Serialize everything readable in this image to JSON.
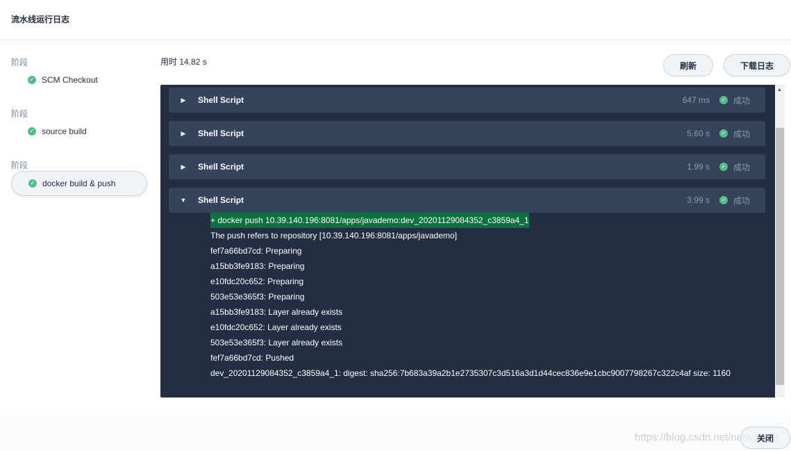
{
  "header": {
    "title": "流水线运行日志"
  },
  "stages": [
    {
      "label": "阶段",
      "name": "SCM Checkout",
      "active": false
    },
    {
      "label": "阶段",
      "name": "source build",
      "active": false
    },
    {
      "label": "阶段",
      "name": "docker build & push",
      "active": true
    }
  ],
  "elapsed": "用时 14.82 s",
  "buttons": {
    "refresh": "刷新",
    "download": "下载日志",
    "close": "关闭"
  },
  "steps": [
    {
      "name": "Shell Script",
      "duration": "647 ms",
      "status": "成功",
      "expanded": false
    },
    {
      "name": "Shell Script",
      "duration": "5.60 s",
      "status": "成功",
      "expanded": false
    },
    {
      "name": "Shell Script",
      "duration": "1.99 s",
      "status": "成功",
      "expanded": false
    },
    {
      "name": "Shell Script",
      "duration": "3.99 s",
      "status": "成功",
      "expanded": true
    }
  ],
  "log": [
    "+ docker push 10.39.140.196:8081/apps/javademo:dev_20201129084352_c3859a4_1",
    "The push refers to repository [10.39.140.196:8081/apps/javademo]",
    "fef7a66bd7cd: Preparing",
    "a15bb3fe9183: Preparing",
    "e10fdc20c652: Preparing",
    "503e53e365f3: Preparing",
    "a15bb3fe9183: Layer already exists",
    "e10fdc20c652: Layer already exists",
    "503e53e365f3: Layer already exists",
    "fef7a66bd7cd: Pushed",
    "dev_20201129084352_c3859a4_1: digest: sha256:7b683a39a2b1e2735307c3d516a3d1d44cec836e9e1cbc9007798267c322c4af size: 1160"
  ],
  "watermark": "https://blog.csdn.net/networken",
  "colors": {
    "success": "#55bc8a",
    "panel": "#242e42",
    "highlight": "#0c7041"
  }
}
